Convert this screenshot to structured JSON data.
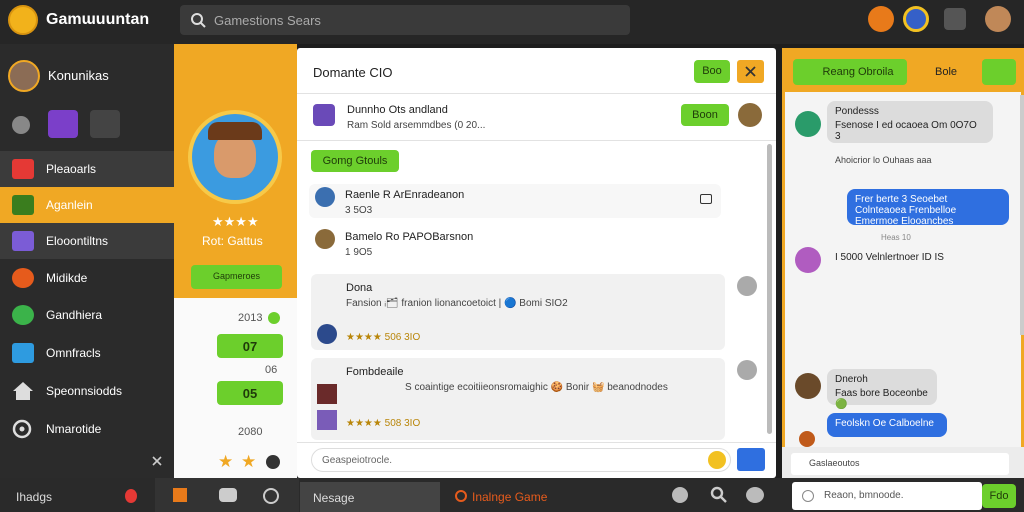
{
  "app": {
    "title": "Gamɯuuntan",
    "search_placeholder": "Gamestions Sears"
  },
  "sidebar": {
    "user_name": "Konunikas",
    "items": [
      {
        "label": "Pleaoarls",
        "icon": "heart-icon",
        "color": "#e53935"
      },
      {
        "label": "Aganlein",
        "icon": "game-icon",
        "color": "#f0a824"
      },
      {
        "label": "Elooontiltns",
        "icon": "library-icon",
        "color": "#7b5cd6"
      },
      {
        "label": "Midikde",
        "icon": "crab-icon",
        "color": "#e65b1c"
      },
      {
        "label": "Gandhiera",
        "icon": "leaf-icon",
        "color": "#3bb34a"
      },
      {
        "label": "Omnfracls",
        "icon": "stack-icon",
        "color": "#2e9be0"
      },
      {
        "label": "Speonnsiodds",
        "icon": "home-icon",
        "color": "#dddddd"
      },
      {
        "label": "Nmarotide",
        "icon": "clock-icon",
        "color": "#dddddd"
      }
    ]
  },
  "profile": {
    "stars": "★★★★",
    "name": "Rot: Gattus",
    "action_label": "Gapmeroes",
    "stat1_label": "2013",
    "stat1_value": "07",
    "stat2_label": "06",
    "stat2_value": "05",
    "stat3_label": "2080"
  },
  "center": {
    "header_title": "Domante CIO",
    "header_btn": "Boo",
    "feed_title": "Dunnho Ots andland",
    "feed_meta": "Ram Sold arsemmdbes (0 20...",
    "feed_btn": "Boon",
    "section_btn": "Gomg Gtouls",
    "rows": [
      {
        "title": "Raenle R ArEnradeanon",
        "meta": "3 5O3"
      },
      {
        "title": "Bamelo Ro PAPOBarsnon",
        "meta": "1 9O5"
      }
    ],
    "cards": [
      {
        "title": "Dona",
        "body": "Fansion ᵢ🗂 franion lionancoetoict | 🔵 Bomi SIO2",
        "meta": "★★★★ 506 3IO"
      },
      {
        "title": "Fombdeaile",
        "body": "S coaintige ecoitiieonsromaighic 🍪 Bonir 🧺 beanodnodes",
        "meta": "★★★★ 508 3IO"
      }
    ],
    "input_placeholder": "Geaspeiotrocle."
  },
  "chat": {
    "header_btn": "Reang Obroila",
    "header_btn2": "Bole",
    "messages": [
      {
        "name": "Pondesss",
        "text": "Fsenose I ed ocaoea Om 0O7O 3"
      },
      {
        "text": "Ahoicrior lo Ouhaas aaa"
      },
      {
        "text": "Frer berte 3 Seoebet Colnteaoea Frenbelloe Emermoe Elooancbes"
      },
      {
        "text": "Heas 10"
      },
      {
        "text": "I 5000 Velnlertnoer  ID IS"
      },
      {
        "name": "Dneroh",
        "text": "Faas bore Boceonbe 🟢"
      },
      {
        "text": "Feolskn Oe Calboelne"
      }
    ],
    "input_placeholder": "Gaslaeoutos"
  },
  "bottombar": {
    "left_label": "Ihadgs",
    "tab_label": "Nesage",
    "game_label": "Inalnge Game",
    "input_placeholder": "Reaon, bmnoode.",
    "send_label": "Fdo"
  },
  "colors": {
    "accent": "#f0a824",
    "green": "#6ccf2c",
    "blue": "#2f6fe0"
  }
}
